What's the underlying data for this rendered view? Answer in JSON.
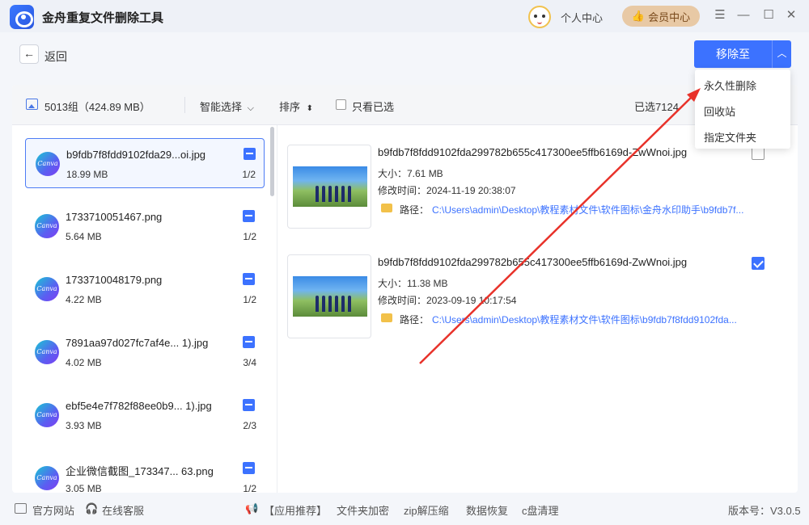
{
  "window": {
    "title": "金舟重复文件删除工具",
    "personal_center": "个人中心",
    "vip_center": "会员中心",
    "controls": [
      "menu-icon",
      "minimize-icon",
      "maximize-icon",
      "close-icon"
    ]
  },
  "nav": {
    "back_label": "返回",
    "move_button": "移除至"
  },
  "toolbar": {
    "group_summary": "5013组（424.89 MB）",
    "smart_select": "智能选择",
    "sort": "排序",
    "only_selected": "只看已选",
    "selected_count": "已选7124"
  },
  "dropdown": {
    "items": [
      "永久性删除",
      "回收站",
      "指定文件夹"
    ]
  },
  "groups": [
    {
      "name": "b9fdb7f8fdd9102fda29...oi.jpg",
      "size": "18.99 MB",
      "count": "1/2"
    },
    {
      "name": "1733710051467.png",
      "size": "5.64 MB",
      "count": "1/2"
    },
    {
      "name": "1733710048179.png",
      "size": "4.22 MB",
      "count": "1/2"
    },
    {
      "name": "7891aa97d027fc7af4e...  1).jpg",
      "size": "4.02 MB",
      "count": "3/4"
    },
    {
      "name": "ebf5e4e7f782f88ee0b9...  1).jpg",
      "size": "3.93 MB",
      "count": "2/3"
    },
    {
      "name": "企业微信截图_173347...  63.png",
      "size": "3.05 MB",
      "count": "1/2"
    }
  ],
  "canva_label": "Canva",
  "files": [
    {
      "name": "b9fdb7f8fdd9102fda299782b655c417300ee5ffb6169d-ZwWnoi.jpg",
      "size": "大小：7.61 MB",
      "time": "修改时间：2024-11-19 20:38:07",
      "path_label": "路径：",
      "path": "C:\\Users\\admin\\Desktop\\教程素材文件\\软件图标\\金舟水印助手\\b9fdb7f...",
      "checked": false
    },
    {
      "name": "b9fdb7f8fdd9102fda299782b655c417300ee5ffb6169d-ZwWnoi.jpg",
      "size": "大小：11.38 MB",
      "time": "修改时间：2023-09-19 10:17:54",
      "path_label": "路径：",
      "path": "C:\\Users\\admin\\Desktop\\教程素材文件\\软件图标\\b9fdb7f8fdd9102fda...",
      "checked": true
    }
  ],
  "footer": {
    "official_site": "官方网站",
    "online_service": "在线客服",
    "app_recommend": "【应用推荐】",
    "links": [
      "文件夹加密",
      "zip解压缩",
      "数据恢复",
      "c盘清理"
    ],
    "version": "版本号：V3.0.5"
  },
  "colors": {
    "accent": "#3c72ff",
    "vip": "#e8c9a5",
    "annotation_arrow": "#e8322a"
  }
}
